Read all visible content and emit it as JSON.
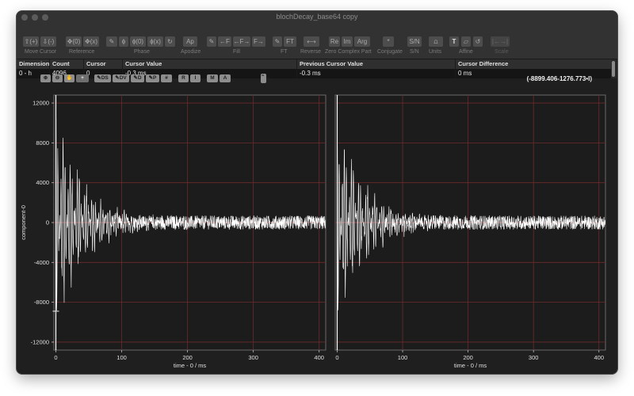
{
  "window": {
    "title": "blochDecay_base64 copy"
  },
  "toolbar": {
    "groups": [
      {
        "label": "Move Cursor",
        "buttons": [
          "⇧(+)",
          "⇩(-)"
        ]
      },
      {
        "label": "Reference",
        "buttons": [
          "✥(0)",
          "✥(x)"
        ]
      },
      {
        "label": "Phase",
        "buttons": [
          "✎",
          "ɸ",
          "ɸ(0)",
          "ɸ(x)",
          "↻"
        ]
      },
      {
        "label": "Apodize",
        "buttons": [
          "Ap"
        ]
      },
      {
        "label": "Fill",
        "buttons": [
          "✎",
          "←F",
          "←F→",
          "F→"
        ]
      },
      {
        "label": "FT",
        "buttons": [
          "✎",
          "FT"
        ]
      },
      {
        "label": "Reverse",
        "buttons": [
          "⟷"
        ]
      },
      {
        "label": "Zero Complex Part",
        "buttons": [
          "Re",
          "Im",
          "Arg"
        ]
      },
      {
        "label": "Conjugate",
        "buttons": [
          "*"
        ]
      },
      {
        "label": "S/N",
        "buttons": [
          "S/N"
        ]
      },
      {
        "label": "Units",
        "buttons": [
          "⩍"
        ]
      },
      {
        "label": "Affine",
        "buttons": [
          "T",
          "▱",
          "↺"
        ]
      },
      {
        "label": "Scale",
        "buttons": [
          "|←→|"
        ]
      }
    ]
  },
  "table": {
    "headers": [
      "Dimension",
      "Count",
      "Cursor Index",
      "Cursor Value",
      "Previous Cursor Value",
      "Cursor Difference"
    ],
    "row": [
      "0 - h",
      "4096",
      "0",
      "-0.3 ms",
      "-0.3 ms",
      "0 ms"
    ]
  },
  "plot_toolbar": {
    "buttons": [
      "⊕",
      "⊖",
      "✋",
      "+",
      "✎DS",
      "✎DV",
      "✎D",
      "✎P",
      "#",
      "R",
      "I",
      "M",
      "A",
      "⌃⌄"
    ]
  },
  "coordinate_readout": "(-8899.406-1276.773•I)",
  "chart_data": [
    {
      "type": "line",
      "title": "",
      "ylabel": "component-0",
      "xlabel": "time - 0 / ms",
      "xlim": [
        -3,
        410
      ],
      "ylim": [
        -12800,
        12800
      ],
      "xticks": [
        0,
        100,
        200,
        300,
        400
      ],
      "yticks": [
        -12000,
        -8000,
        -4000,
        0,
        4000,
        8000,
        12000
      ],
      "grid": true,
      "series": [
        {
          "name": "",
          "decay_ms": 40,
          "peak_amplitude": 13000,
          "noise_amplitude": 700,
          "color": "#ffffff"
        }
      ]
    },
    {
      "type": "line",
      "title": "",
      "ylabel": "",
      "xlabel": "time - 0 / ms",
      "xlim": [
        -3,
        410
      ],
      "ylim": [
        -12800,
        12800
      ],
      "xticks": [
        0,
        100,
        200,
        300,
        400
      ],
      "yticks": [
        -12000,
        -8000,
        -4000,
        0,
        4000,
        8000,
        12000
      ],
      "grid": true,
      "series": [
        {
          "name": "",
          "decay_ms": 40,
          "peak_amplitude": 12500,
          "noise_amplitude": 700,
          "color": "#ffffff"
        }
      ]
    }
  ]
}
